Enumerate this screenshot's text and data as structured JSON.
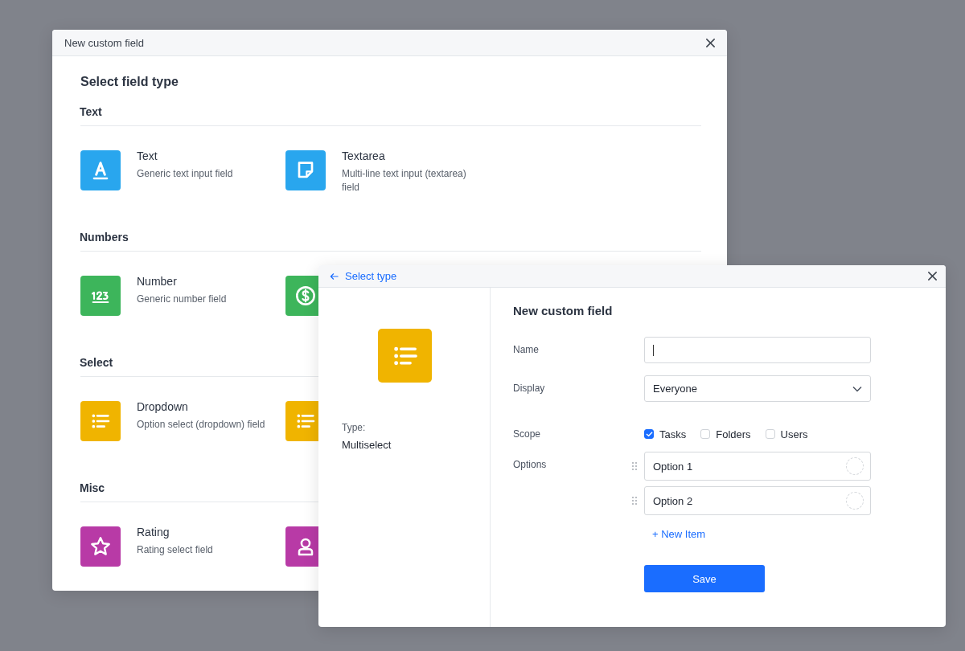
{
  "back_dialog": {
    "title": "New custom field",
    "heading": "Select field type",
    "sections": [
      {
        "title": "Text",
        "items": [
          {
            "kind": "letter",
            "color": "#29a6ee",
            "title": "Text",
            "description": "Generic text input field"
          },
          {
            "kind": "note",
            "color": "#29a6ee",
            "title": "Textarea",
            "description": "Multi-line text input (textarea) field"
          }
        ]
      },
      {
        "title": "Numbers",
        "items": [
          {
            "kind": "digits",
            "color": "#3db55b",
            "title": "Number",
            "description": "Generic number field"
          },
          {
            "kind": "dollar",
            "color": "#3db55b"
          }
        ]
      },
      {
        "title": "Select",
        "items": [
          {
            "kind": "list",
            "color": "#f0b400",
            "title": "Dropdown",
            "description": "Option select (dropdown) field"
          },
          {
            "kind": "list",
            "color": "#f0b400"
          }
        ]
      },
      {
        "title": "Misc",
        "items": [
          {
            "kind": "star",
            "color": "#b83aa6",
            "title": "Rating",
            "description": "Rating select field"
          },
          {
            "kind": "person",
            "color": "#b83aa6"
          }
        ]
      }
    ]
  },
  "front_dialog": {
    "back_link": "Select type",
    "type": {
      "kind": "list",
      "label": "Type:",
      "value": "Multiselect"
    },
    "heading": "New custom field",
    "form": [
      {
        "kind": "input",
        "label": "Name",
        "focused": true
      },
      {
        "kind": "select",
        "label": "Display",
        "value": "Everyone"
      },
      {
        "kind": "checkboxes",
        "label": "Scope",
        "options": [
          {
            "label": "Tasks",
            "checked": true
          },
          {
            "label": "Folders",
            "checked": false
          },
          {
            "label": "Users",
            "checked": false
          }
        ]
      },
      {
        "kind": "options",
        "label": "Options",
        "options": [
          "Option 1",
          "Option 2"
        ],
        "add_label": "+ New Item"
      }
    ],
    "save_button": "Save"
  }
}
